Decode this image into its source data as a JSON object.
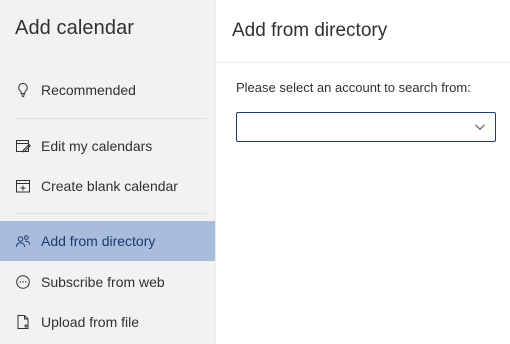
{
  "sidebar": {
    "title": "Add calendar",
    "items": [
      {
        "label": "Recommended",
        "icon": "lightbulb-icon"
      },
      {
        "label": "Edit my calendars",
        "icon": "edit-calendar-icon"
      },
      {
        "label": "Create blank calendar",
        "icon": "add-calendar-icon"
      },
      {
        "label": "Add from directory",
        "icon": "people-icon",
        "selected": true
      },
      {
        "label": "Subscribe from web",
        "icon": "globe-more-icon"
      },
      {
        "label": "Upload from file",
        "icon": "file-upload-icon"
      }
    ]
  },
  "main": {
    "title": "Add from directory",
    "account_label": "Please select an account to search from:",
    "account_select": {
      "value": ""
    }
  },
  "colors": {
    "sidebar_bg": "#f3f2f1",
    "selected_bg": "#a8bcdc",
    "accent": "#1f3a6e"
  }
}
